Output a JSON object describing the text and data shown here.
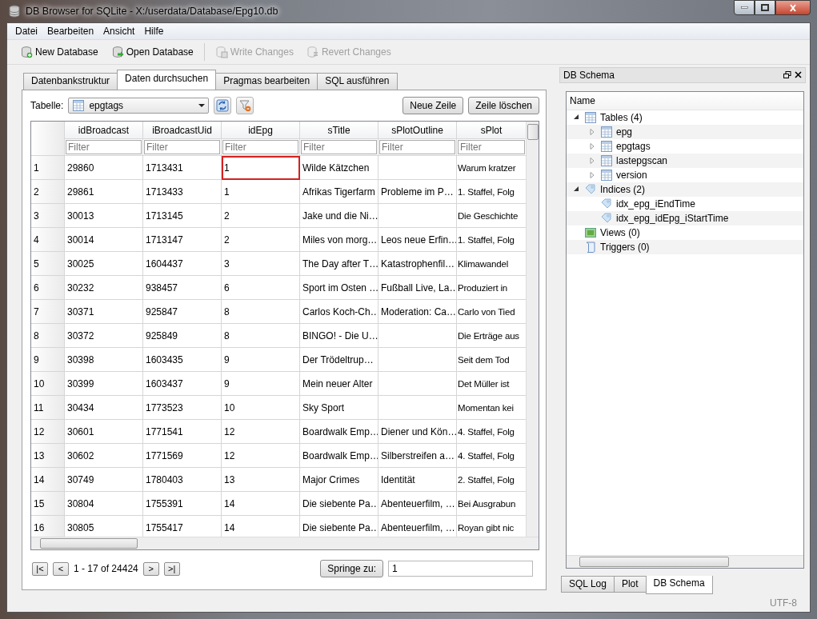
{
  "window": {
    "title": "DB Browser for SQLite - X:/userdata/Database/Epg10.db"
  },
  "menu": [
    "Datei",
    "Bearbeiten",
    "Ansicht",
    "Hilfe"
  ],
  "toolbar": [
    {
      "label": "New Database",
      "kind": "new",
      "disabled": false
    },
    {
      "label": "Open Database",
      "kind": "open",
      "disabled": false
    },
    {
      "label": "Write Changes",
      "kind": "write",
      "disabled": true
    },
    {
      "label": "Revert Changes",
      "kind": "revert",
      "disabled": true
    }
  ],
  "tabs": [
    {
      "label": "Datenbankstruktur",
      "selected": false
    },
    {
      "label": "Daten durchsuchen",
      "selected": true
    },
    {
      "label": "Pragmas bearbeiten",
      "selected": false
    },
    {
      "label": "SQL ausführen",
      "selected": false
    }
  ],
  "browse": {
    "table_label": "Tabelle:",
    "table_value": "epgtags",
    "buttons": [
      "Neue Zeile",
      "Zeile löschen"
    ],
    "columns": [
      "idBroadcast",
      "iBroadcastUid",
      "idEpg",
      "sTitle",
      "sPlotOutline",
      "sPlot"
    ],
    "filter_placeholders": [
      "Filter",
      "Filter",
      "Filter",
      "Filter",
      "Filter",
      "Filter"
    ],
    "rows": [
      {
        "header": "1",
        "cells": [
          {
            "text": "29860",
            "selected": false
          },
          {
            "text": "1713431",
            "selected": false
          },
          {
            "text": "1",
            "selected": true
          },
          {
            "text": "Wilde Kätzchen",
            "selected": false
          },
          {
            "selected": false
          },
          {
            "text": "Warum kratzer",
            "selected": false
          }
        ]
      },
      {
        "header": "2",
        "cells": [
          {
            "text": "29861",
            "selected": false
          },
          {
            "text": "1713433",
            "selected": false
          },
          {
            "text": "1",
            "selected": false
          },
          {
            "text": "Afrikas Tigerfarm",
            "selected": false
          },
          {
            "text": "Probleme im P…",
            "selected": false
          },
          {
            "text": "1. Staffel, Folg",
            "selected": false
          }
        ]
      },
      {
        "header": "3",
        "cells": [
          {
            "text": "30013",
            "selected": false
          },
          {
            "text": "1713145",
            "selected": false
          },
          {
            "text": "2",
            "selected": false
          },
          {
            "text": "Jake und die Ni…",
            "selected": false
          },
          {
            "selected": false
          },
          {
            "text": "Die Geschichte",
            "selected": false
          }
        ]
      },
      {
        "header": "4",
        "cells": [
          {
            "text": "30014",
            "selected": false
          },
          {
            "text": "1713147",
            "selected": false
          },
          {
            "text": "2",
            "selected": false
          },
          {
            "text": "Miles von morg…",
            "selected": false
          },
          {
            "text": "Leos neue Erfin…",
            "selected": false
          },
          {
            "text": "1. Staffel, Folg",
            "selected": false
          }
        ]
      },
      {
        "header": "5",
        "cells": [
          {
            "text": "30025",
            "selected": false
          },
          {
            "text": "1604437",
            "selected": false
          },
          {
            "text": "3",
            "selected": false
          },
          {
            "text": "The Day after T…",
            "selected": false
          },
          {
            "text": "Katastrophenfil…",
            "selected": false
          },
          {
            "text": "Klimawandel",
            "selected": false
          }
        ]
      },
      {
        "header": "6",
        "cells": [
          {
            "text": "30232",
            "selected": false
          },
          {
            "text": "938457",
            "selected": false
          },
          {
            "text": "6",
            "selected": false
          },
          {
            "text": "Sport im Osten …",
            "selected": false
          },
          {
            "text": "Fußball Live, La…",
            "selected": false
          },
          {
            "text": " Produziert in",
            "selected": false
          }
        ]
      },
      {
        "header": "7",
        "cells": [
          {
            "text": "30371",
            "selected": false
          },
          {
            "text": "925847",
            "selected": false
          },
          {
            "text": "8",
            "selected": false
          },
          {
            "text": "Carlos Koch-Ch…",
            "selected": false
          },
          {
            "text": "Moderation: Ca…",
            "selected": false
          },
          {
            "text": "Carlo von Tied",
            "selected": false
          }
        ]
      },
      {
        "header": "8",
        "cells": [
          {
            "text": "30372",
            "selected": false
          },
          {
            "text": "925849",
            "selected": false
          },
          {
            "text": "8",
            "selected": false
          },
          {
            "text": "BINGO! - Die U…",
            "selected": false
          },
          {
            "selected": false
          },
          {
            "text": "Die Erträge aus",
            "selected": false
          }
        ]
      },
      {
        "header": "9",
        "cells": [
          {
            "text": "30398",
            "selected": false
          },
          {
            "text": "1603435",
            "selected": false
          },
          {
            "text": "9",
            "selected": false
          },
          {
            "text": "Der Trödeltrup…",
            "selected": false
          },
          {
            "selected": false
          },
          {
            "text": "Seit dem Tod",
            "selected": false
          }
        ]
      },
      {
        "header": "10",
        "cells": [
          {
            "text": "30399",
            "selected": false
          },
          {
            "text": "1603437",
            "selected": false
          },
          {
            "text": "9",
            "selected": false
          },
          {
            "text": "Mein neuer Alter",
            "selected": false
          },
          {
            "selected": false
          },
          {
            "text": "Det Müller ist",
            "selected": false
          }
        ]
      },
      {
        "header": "11",
        "cells": [
          {
            "text": "30434",
            "selected": false
          },
          {
            "text": "1773523",
            "selected": false
          },
          {
            "text": "10",
            "selected": false
          },
          {
            "text": "Sky Sport",
            "selected": false
          },
          {
            "selected": false
          },
          {
            "text": "Momentan kei",
            "selected": false
          }
        ]
      },
      {
        "header": "12",
        "cells": [
          {
            "text": "30601",
            "selected": false
          },
          {
            "text": "1771541",
            "selected": false
          },
          {
            "text": "12",
            "selected": false
          },
          {
            "text": "Boardwalk Emp…",
            "selected": false
          },
          {
            "text": "Diener und Kön…",
            "selected": false
          },
          {
            "text": "4. Staffel, Folg",
            "selected": false
          }
        ]
      },
      {
        "header": "13",
        "cells": [
          {
            "text": "30602",
            "selected": false
          },
          {
            "text": "1771569",
            "selected": false
          },
          {
            "text": "12",
            "selected": false
          },
          {
            "text": "Boardwalk Emp…",
            "selected": false
          },
          {
            "text": "Silberstreifen a…",
            "selected": false
          },
          {
            "text": "4. Staffel, Folg",
            "selected": false
          }
        ]
      },
      {
        "header": "14",
        "cells": [
          {
            "text": "30749",
            "selected": false
          },
          {
            "text": "1780403",
            "selected": false
          },
          {
            "text": "13",
            "selected": false
          },
          {
            "text": "Major Crimes",
            "selected": false
          },
          {
            "text": "Identität",
            "selected": false
          },
          {
            "text": "2. Staffel, Folg",
            "selected": false
          }
        ]
      },
      {
        "header": "15",
        "cells": [
          {
            "text": "30804",
            "selected": false
          },
          {
            "text": "1755391",
            "selected": false
          },
          {
            "text": "14",
            "selected": false
          },
          {
            "text": "Die siebente Pa…",
            "selected": false
          },
          {
            "text": "Abenteuerfilm, …",
            "selected": false
          },
          {
            "text": "Bei Ausgrabun",
            "selected": false
          }
        ]
      },
      {
        "header": "16",
        "cells": [
          {
            "text": "30805",
            "selected": false
          },
          {
            "text": "1755417",
            "selected": false
          },
          {
            "text": "14",
            "selected": false
          },
          {
            "text": "Die siebente Pa…",
            "selected": false
          },
          {
            "text": "Abenteuerfilm, …",
            "selected": false
          },
          {
            "text": "Royan gibt nic",
            "selected": false
          }
        ]
      }
    ],
    "pager": {
      "buttons": [
        "|<",
        "<",
        ">",
        ">|"
      ],
      "range": "1 - 17 of 24424",
      "goto_button": "Springe zu:",
      "goto_value": "1"
    }
  },
  "schema": {
    "title": "DB Schema",
    "header": "Name",
    "tree": [
      {
        "label": "Tables (4)",
        "kind": "table",
        "expanded": true,
        "children": [
          {
            "label": "epg",
            "kind": "table",
            "expanded": false
          },
          {
            "label": "epgtags",
            "kind": "table",
            "expanded": false
          },
          {
            "label": "lastepgscan",
            "kind": "table",
            "expanded": false
          },
          {
            "label": "version",
            "kind": "table",
            "expanded": false
          }
        ]
      },
      {
        "label": "Indices (2)",
        "kind": "index",
        "expanded": true,
        "children": [
          {
            "label": "idx_epg_iEndTime",
            "kind": "index"
          },
          {
            "label": "idx_epg_idEpg_iStartTime",
            "kind": "index"
          }
        ]
      },
      {
        "label": "Views (0)",
        "kind": "view"
      },
      {
        "label": "Triggers (0)",
        "kind": "trigger"
      }
    ]
  },
  "dock_tabs": [
    {
      "label": "SQL Log",
      "selected": false
    },
    {
      "label": "Plot",
      "selected": false
    },
    {
      "label": "DB Schema",
      "selected": true
    }
  ],
  "status_bar": {
    "encoding": "UTF-8"
  }
}
